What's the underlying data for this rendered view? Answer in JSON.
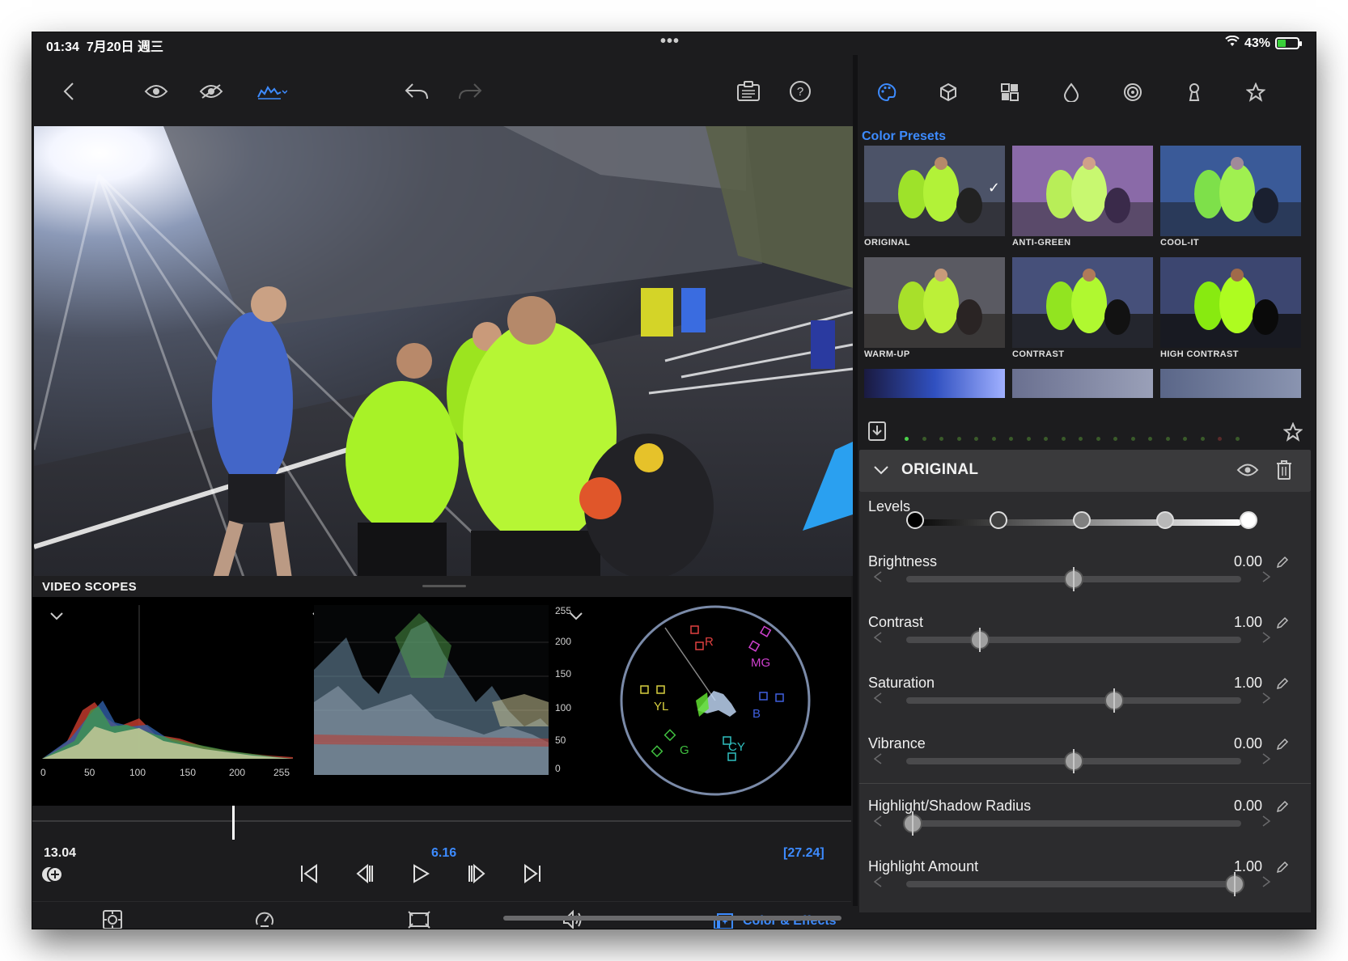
{
  "status": {
    "time": "01:34",
    "date": "7月20日 週三",
    "battery_pct": "43%",
    "battery_level": 0.43,
    "more": "•••"
  },
  "toolbar": {
    "back_icon": "chevron-left-icon",
    "view_icons": [
      "eye-icon",
      "eye-slash-icon",
      "scopes-toggle-icon"
    ],
    "undo_icon": "undo-icon",
    "redo_icon": "redo-icon",
    "clipboard_icon": "clipboard-icon",
    "help_icon": "help-icon"
  },
  "scopes": {
    "title": "VIDEO SCOPES",
    "histogram_ticks": [
      "0",
      "50",
      "100",
      "150",
      "200",
      "255"
    ],
    "waveform_ticks": [
      "255",
      "200",
      "150",
      "100",
      "50",
      "0"
    ],
    "vector_labels": [
      "R",
      "MG",
      "B",
      "CY",
      "G",
      "YL"
    ]
  },
  "timeline": {
    "current": "13.04",
    "selection": "6.16",
    "duration": "[27.24]"
  },
  "bottom": {
    "icons": [
      "viewer-icon",
      "speed-icon",
      "crop-icon",
      "audio-icon"
    ],
    "active_label": "Color & Effects",
    "active_icon": "color-effects-icon"
  },
  "right": {
    "tabs": [
      "palette-icon",
      "cube-icon",
      "grid-icon",
      "drop-icon",
      "spiral-icon",
      "keyhole-icon",
      "star-icon"
    ],
    "presets_title": "Color Presets",
    "presets": [
      {
        "label": "ORIGINAL",
        "selected": true
      },
      {
        "label": "ANTI-GREEN",
        "selected": false
      },
      {
        "label": "COOL-IT",
        "selected": false
      },
      {
        "label": "WARM-UP",
        "selected": false
      },
      {
        "label": "CONTRAST",
        "selected": false
      },
      {
        "label": "HIGH CONTRAST",
        "selected": false
      }
    ],
    "section_name": "ORIGINAL",
    "levels_label": "Levels",
    "sliders": [
      {
        "label": "Brightness",
        "value": "0.00",
        "level": 0.5
      },
      {
        "label": "Contrast",
        "value": "1.00",
        "level": 0.22
      },
      {
        "label": "Saturation",
        "value": "1.00",
        "level": 0.62
      },
      {
        "label": "Vibrance",
        "value": "0.00",
        "level": 0.5
      },
      {
        "label": "Highlight/Shadow Radius",
        "value": "0.00",
        "level": 0.02
      },
      {
        "label": "Highlight Amount",
        "value": "1.00",
        "level": 0.98
      }
    ]
  }
}
